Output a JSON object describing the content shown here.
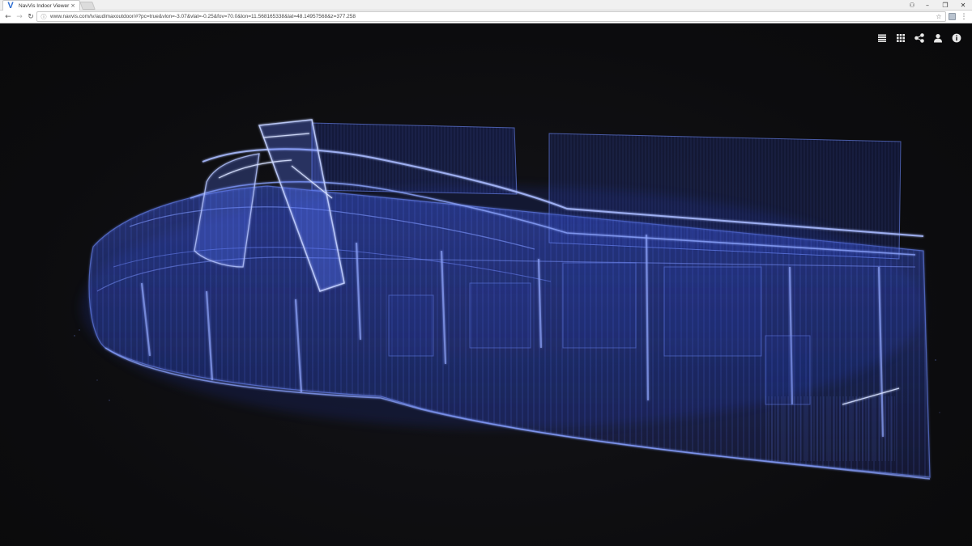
{
  "browser": {
    "tab_title": "NavVis Indoor Viewer",
    "tab_close_glyph": "×",
    "url": "www.navvis.com/iv/audimaxoutdoor/#?pc=true&vlon=-3.07&vlat=-0.25&fov=70.0&lon=11.568165338&lat=48.14957568&z=377.258",
    "window_controls": [
      "–",
      "❐",
      "✕"
    ]
  },
  "viewer": {
    "toolbar_icons": [
      "layers-icon",
      "grid-icon",
      "share-icon",
      "user-icon",
      "info-icon"
    ]
  },
  "colors": {
    "pointcloud_primary": "#4a6cff",
    "pointcloud_highlight": "#9fb6ff",
    "background": "#0e0e10"
  }
}
